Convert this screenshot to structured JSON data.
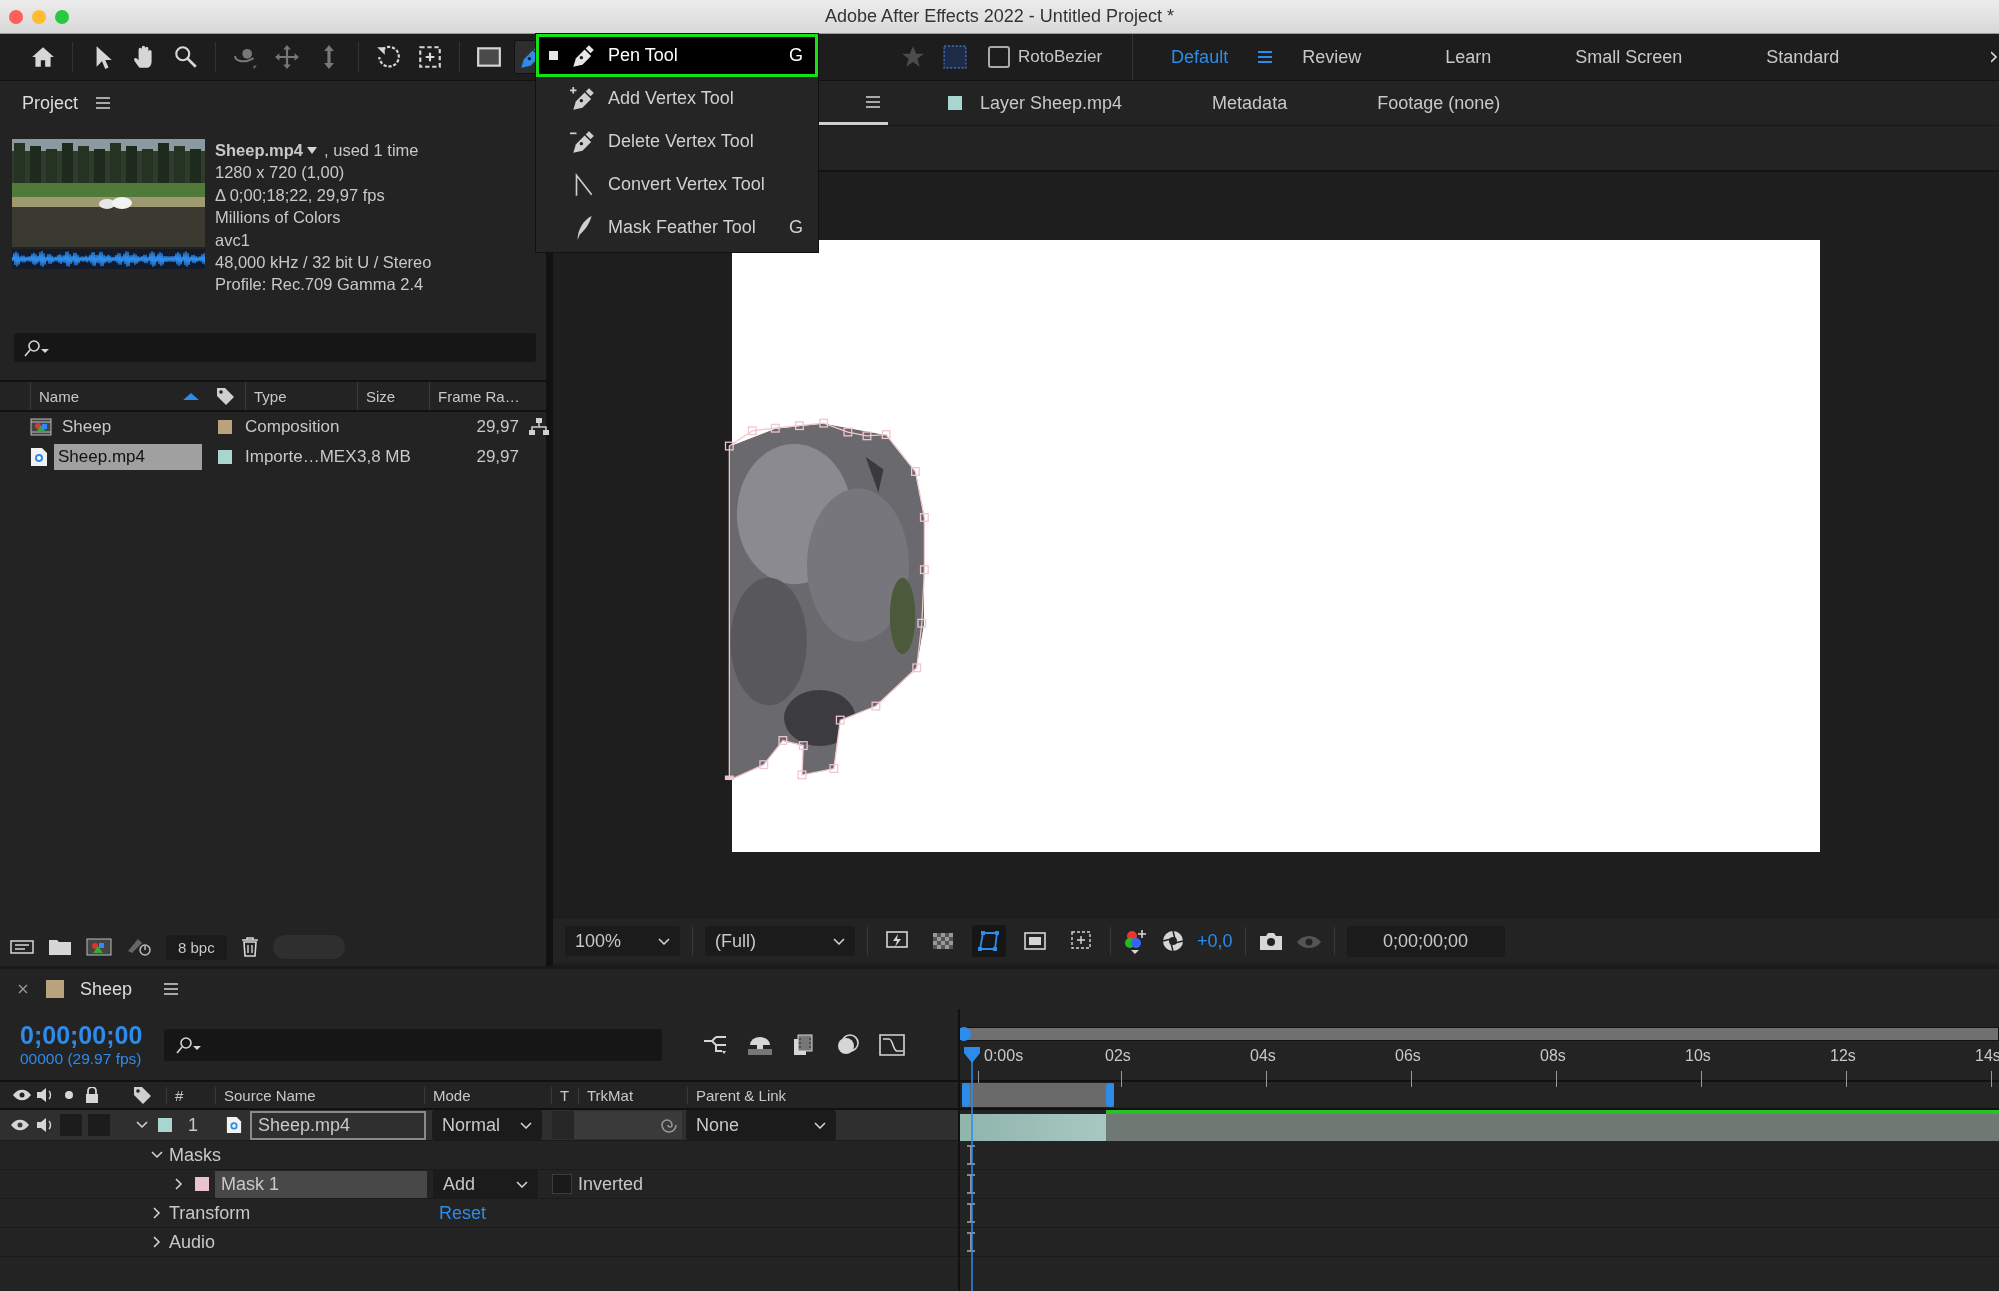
{
  "window": {
    "title": "Adobe After Effects 2022 - Untitled Project *"
  },
  "toolbar": {
    "tools": [
      {
        "kind": "home",
        "selected": false
      },
      {
        "kind": "selection",
        "selected": false
      },
      {
        "kind": "hand",
        "selected": false
      },
      {
        "kind": "zoom",
        "selected": false
      },
      {
        "kind": "orbit",
        "selected": false
      },
      {
        "kind": "pan",
        "selected": false
      },
      {
        "kind": "dolly",
        "selected": false
      },
      {
        "kind": "rotate",
        "selected": false
      },
      {
        "kind": "anchor",
        "selected": false
      },
      {
        "kind": "rectangle",
        "selected": false
      },
      {
        "kind": "pen",
        "selected": true
      },
      {
        "kind": "puppet",
        "selected": false
      },
      {
        "kind": "roto",
        "selected": false
      }
    ],
    "rotobezier": {
      "label": "RotoBezier",
      "checked": false
    },
    "workspaces": [
      {
        "label": "Default",
        "selected": true
      },
      {
        "label": "Review",
        "selected": false
      },
      {
        "label": "Learn",
        "selected": false
      },
      {
        "label": "Small Screen",
        "selected": false
      },
      {
        "label": "Standard",
        "selected": false
      }
    ]
  },
  "tool_menu": [
    {
      "kind": "pen",
      "label": "Pen Tool",
      "shortcut": "G",
      "selected": true
    },
    {
      "kind": "add",
      "label": "Add Vertex Tool",
      "selected": false
    },
    {
      "kind": "delete",
      "label": "Delete Vertex Tool",
      "selected": false
    },
    {
      "kind": "convert",
      "label": "Convert Vertex Tool",
      "selected": false
    },
    {
      "kind": "feather",
      "label": "Mask Feather Tool",
      "shortcut": "G",
      "selected": false
    }
  ],
  "project": {
    "title": "Project",
    "info": {
      "name": "Sheep.mp4",
      "usage": ", used 1 time",
      "lines": [
        "1280 x 720 (1,00)",
        "Δ 0;00;18;22, 29,97 fps",
        "Millions of Colors",
        "avc1",
        "48,000 kHz / 32 bit U / Stereo",
        "Profile: Rec.709 Gamma 2.4"
      ]
    },
    "columns": [
      {
        "kind": "text",
        "label": "Name",
        "sorted": true
      },
      {
        "kind": "tag"
      },
      {
        "kind": "text",
        "label": "Type",
        "sorted": false
      },
      {
        "kind": "text",
        "label": "Size",
        "sorted": false
      },
      {
        "kind": "text",
        "label": "Frame Ra…",
        "sorted": false
      }
    ],
    "rows": [
      {
        "kind": "composition",
        "name": "Sheep",
        "color": "#b9a37f",
        "type": "Composition",
        "frame_rate": "29,97",
        "selected": false
      },
      {
        "kind": "footage",
        "name": "Sheep.mp4",
        "color": "#a9d5d0",
        "type": "Importe…MEX",
        "size": "3,8 MB",
        "frame_rate": "29,97",
        "selected": true
      }
    ],
    "bit_depth": "8 bpc"
  },
  "viewer": {
    "tabs": [
      {
        "label": "Layer Sheep.mp4",
        "color": "#a9d5d0"
      },
      {
        "label": "Metadata"
      },
      {
        "label": "Footage (none)"
      }
    ],
    "magnification": "100%",
    "resolution": "(Full)",
    "toggles": [
      {
        "kind": "fast-preview",
        "on": false
      },
      {
        "kind": "transparency",
        "on": false
      },
      {
        "kind": "mask",
        "on": true
      },
      {
        "kind": "safe-area",
        "on": false
      },
      {
        "kind": "grid",
        "on": false
      }
    ],
    "exposure": "+0,0",
    "timecode": "0;00;00;00"
  },
  "timeline": {
    "tab": {
      "label": "Sheep",
      "color": "#b9a37f"
    },
    "time": "0;00;00;00",
    "frames": "00000 (29.97 fps)",
    "columns": [
      "#",
      "Source Name",
      "Mode",
      "T",
      "TrkMat",
      "Parent & Link"
    ],
    "ruler": [
      "0:00s",
      "02s",
      "04s",
      "06s",
      "08s",
      "10s",
      "12s",
      "14s"
    ],
    "layers": [
      {
        "number": "1",
        "name": "Sheep.mp4",
        "color": "#a9d5d0",
        "mode": "Normal",
        "parent": "None",
        "video": true,
        "audio": true,
        "expanded": true
      }
    ],
    "properties": [
      {
        "kind": "group",
        "label": "Masks",
        "expanded": true,
        "children": [
          {
            "kind": "mask",
            "label": "Mask 1",
            "color": "#e9c3cd",
            "mode": "Add",
            "option": "Inverted",
            "inverted": false,
            "expanded": false
          }
        ]
      },
      {
        "kind": "group",
        "label": "Transform",
        "expanded": false,
        "value": "Reset"
      },
      {
        "kind": "group",
        "label": "Audio",
        "expanded": false
      }
    ]
  }
}
